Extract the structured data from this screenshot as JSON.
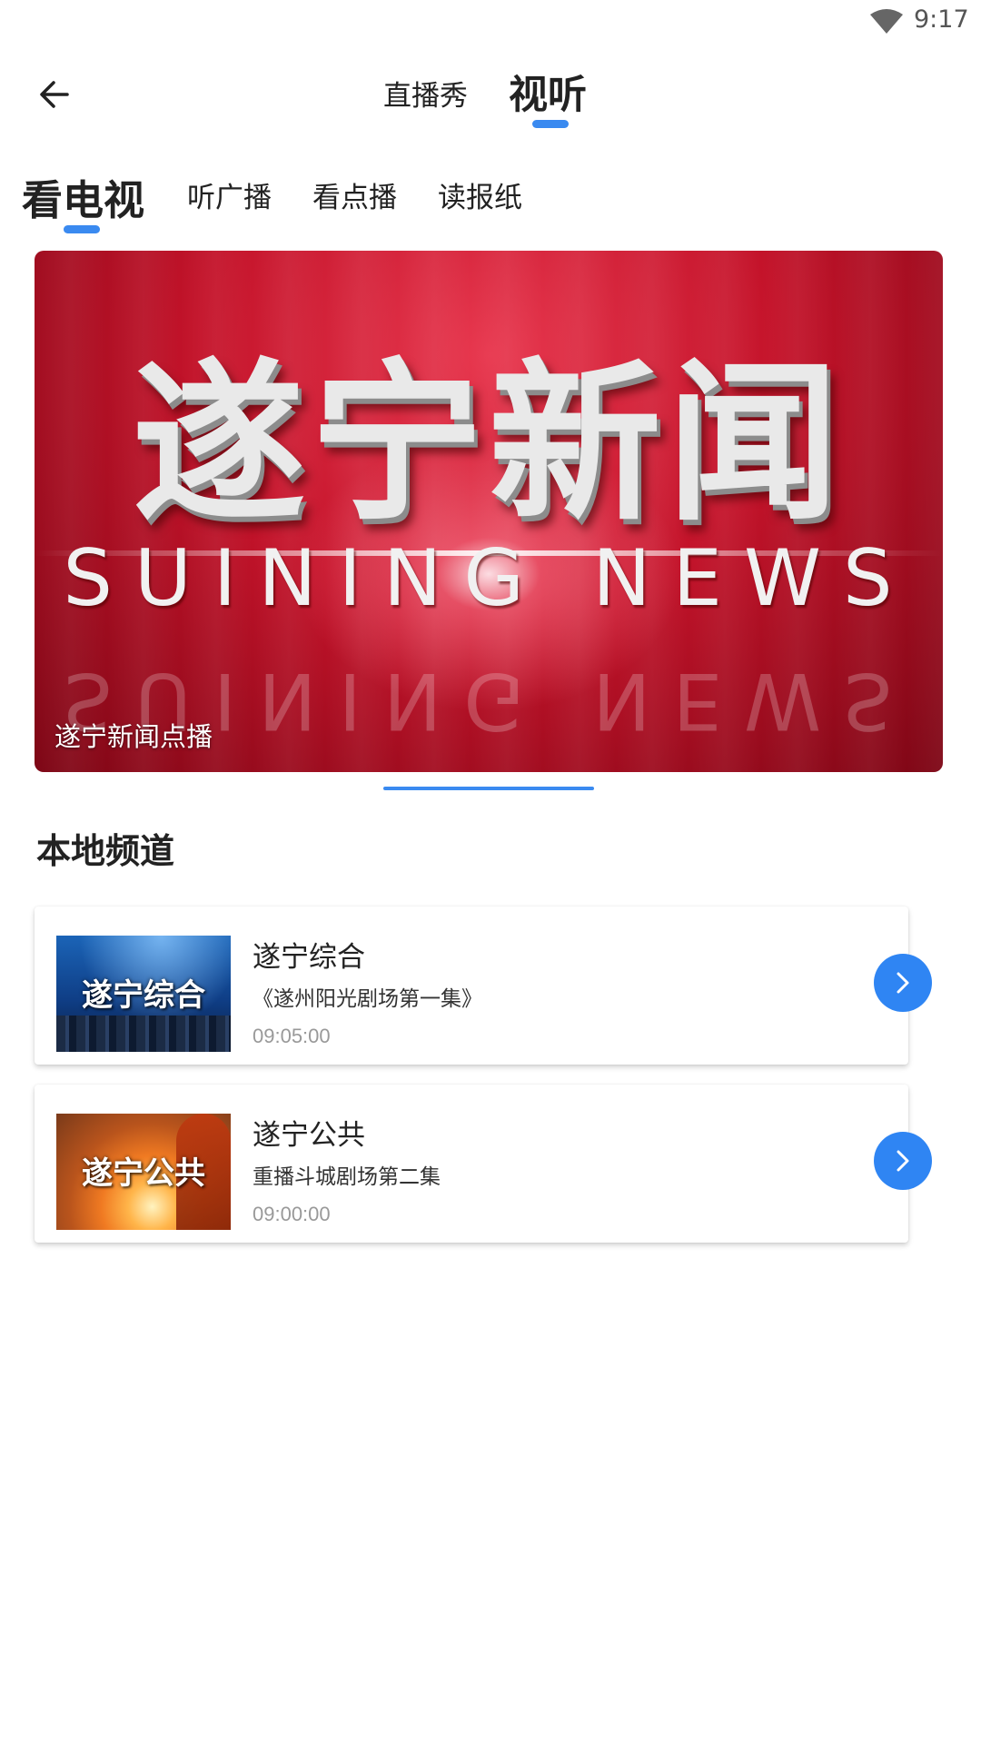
{
  "status_bar": {
    "time": "9:17",
    "icons": [
      "wifi-icon"
    ]
  },
  "header": {
    "back_icon": "back-arrow-icon",
    "tabs": [
      {
        "label": "直播秀",
        "active": false
      },
      {
        "label": "视听",
        "active": true
      }
    ],
    "accent_color": "#3a8af0"
  },
  "sub_tabs": [
    {
      "label": "看电视",
      "active": true
    },
    {
      "label": "听广播",
      "active": false
    },
    {
      "label": "看点播",
      "active": false
    },
    {
      "label": "读报纸",
      "active": false
    }
  ],
  "banner": {
    "logo_cn": "遂宁新闻",
    "logo_en": "SUINING NEWS",
    "caption": "遂宁新闻点播"
  },
  "section": {
    "title": "本地频道"
  },
  "channels": [
    {
      "thumb_label": "遂宁综合",
      "name": "遂宁综合",
      "program": "《遂州阳光剧场第一集》",
      "time": "09:05:00",
      "action_icon": "chevron-right-icon"
    },
    {
      "thumb_label": "遂宁公共",
      "name": "遂宁公共",
      "program": "重播斗城剧场第二集",
      "time": "09:00:00",
      "action_icon": "chevron-right-icon"
    }
  ],
  "colors": {
    "accent": "#3a8af0",
    "arrow_button": "#2f85f3"
  }
}
